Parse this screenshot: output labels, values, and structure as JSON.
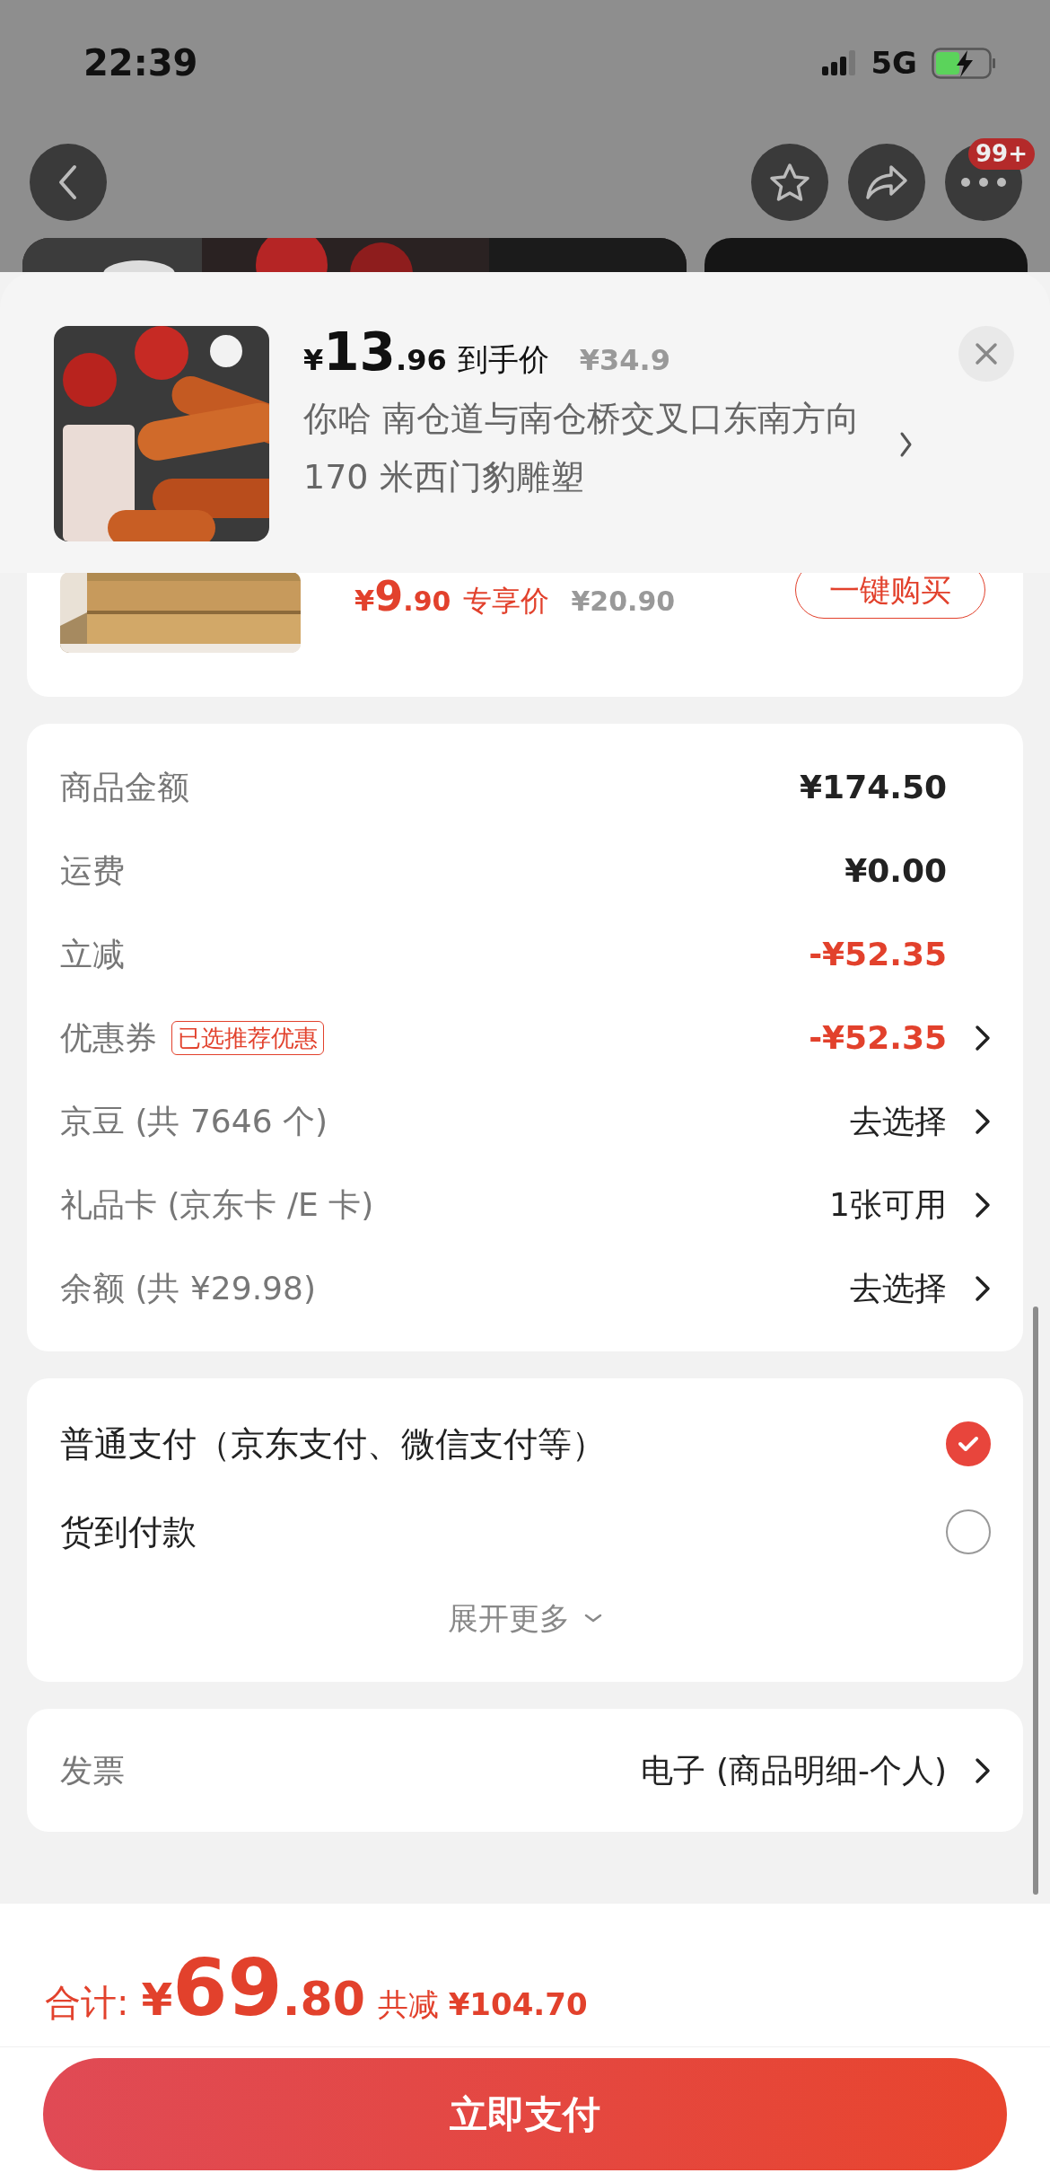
{
  "status_bar": {
    "time": "22:39",
    "network": "5G"
  },
  "nav": {
    "badge": "99+"
  },
  "popup": {
    "currency": "¥",
    "price_int": "13",
    "price_dec": ".96",
    "price_label": "到手价",
    "original_price": "¥34.9",
    "address": "你哈  南仓道与南仓桥交叉口东南方向 170 米西门豹雕塑"
  },
  "recommend": {
    "currency": "¥",
    "price_int": "9",
    "price_dec": ".90",
    "price_label": "专享价",
    "original_price": "¥20.90",
    "button": "一键购买"
  },
  "summary": [
    {
      "label": "商品金额",
      "value": "¥174.50",
      "kind": "amount",
      "arrow": false
    },
    {
      "label": "运费",
      "value": "¥0.00",
      "kind": "amount",
      "arrow": false
    },
    {
      "label": "立减",
      "value": "-¥52.35",
      "kind": "discount",
      "arrow": false
    },
    {
      "label": "优惠券",
      "tag": "已选推荐优惠",
      "value": "-¥52.35",
      "kind": "discount",
      "arrow": true
    },
    {
      "label": "京豆 (共 7646 个)",
      "value": "去选择",
      "kind": "action",
      "arrow": true
    },
    {
      "label": "礼品卡 (京东卡 /E 卡)",
      "value": "1张可用",
      "kind": "action",
      "arrow": true
    },
    {
      "label": "余额 (共 ¥29.98)",
      "value": "去选择",
      "kind": "action",
      "arrow": true
    }
  ],
  "payment": {
    "options": [
      {
        "label": "普通支付（京东支付、微信支付等）",
        "selected": true
      },
      {
        "label": "货到付款",
        "selected": false
      }
    ],
    "expand": "展开更多"
  },
  "invoice": {
    "label": "发票",
    "value": "电子 (商品明细-个人)"
  },
  "footer": {
    "total_label": "合计:",
    "currency": "¥",
    "total_int": "69",
    "total_dec": ".80",
    "saved": "共减 **¥104.70**",
    "pay_button": "立即支付"
  }
}
